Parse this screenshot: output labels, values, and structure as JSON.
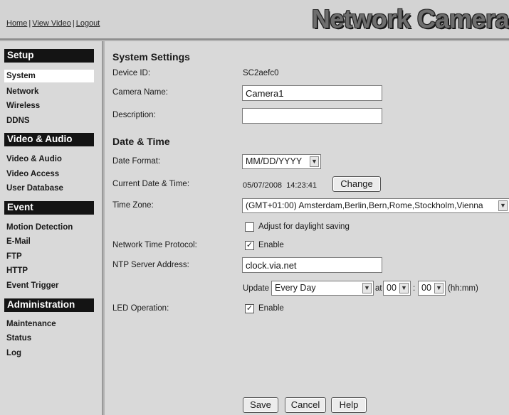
{
  "header": {
    "links": [
      "Home",
      "View Video",
      "Logout"
    ],
    "brand": "Network Camera"
  },
  "sidebar": {
    "setup": {
      "title": "Setup",
      "items": [
        "System",
        "Network",
        "Wireless",
        "DDNS"
      ]
    },
    "video_audio": {
      "title": "Video & Audio",
      "items": [
        "Video & Audio",
        "Video Access",
        "User Database"
      ]
    },
    "event": {
      "title": "Event",
      "items": [
        "Motion Detection",
        "E-Mail",
        "FTP",
        "HTTP",
        "Event Trigger"
      ]
    },
    "administration": {
      "title": "Administration",
      "items": [
        "Maintenance",
        "Status",
        "Log"
      ]
    }
  },
  "system_settings": {
    "title": "System Settings",
    "device_id_label": "Device ID:",
    "device_id_value": "SC2aefc0",
    "camera_name_label": "Camera Name:",
    "camera_name_value": "Camera1",
    "description_label": "Description:",
    "description_value": ""
  },
  "date_time": {
    "title": "Date & Time",
    "date_format_label": "Date Format:",
    "date_format_value": "MM/DD/YYYY",
    "current_label": "Current Date & Time:",
    "current_value": "05/07/2008  14:23:41",
    "change_label": "Change",
    "timezone_label": "Time Zone:",
    "timezone_value": "(GMT+01:00) Amsterdam,Berlin,Bern,Rome,Stockholm,Vienna",
    "daylight_label": "Adjust for daylight saving",
    "daylight_checked": false,
    "ntp_label": "Network Time Protocol:",
    "ntp_enable_label": "Enable",
    "ntp_checked": true,
    "ntp_server_label": "NTP Server Address:",
    "ntp_server_value": "clock.via.net",
    "update_label": "Update",
    "update_value": "Every Day",
    "at_label": "at",
    "hour_value": "00",
    "colon": ":",
    "minute_value": "00",
    "hhmm_label": "(hh:mm)"
  },
  "led": {
    "label": "LED Operation:",
    "enable_label": "Enable",
    "checked": true
  },
  "footer_buttons": {
    "save": "Save",
    "cancel": "Cancel",
    "help": "Help"
  }
}
